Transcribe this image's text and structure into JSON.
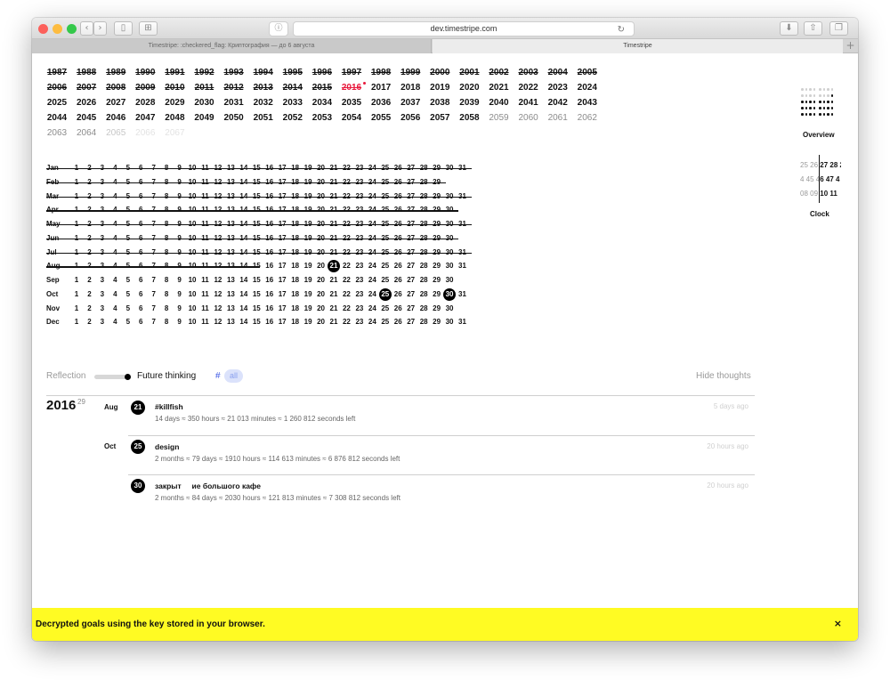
{
  "browser": {
    "url": "dev.timestripe.com",
    "reader_glyph": "ⓘ",
    "reload_glyph": "↻",
    "back_glyph": "‹",
    "forward_glyph": "›",
    "sidebar_glyph": "▯",
    "tabs_glyph": "⊞",
    "download_glyph": "⬇",
    "share_glyph": "⇧",
    "newwin_glyph": "❐",
    "tabs": [
      {
        "label": "Timestripe: :checkered_flag: Криптография — до 6 августа"
      },
      {
        "label": "Timestripe"
      }
    ],
    "new_tab_glyph": "+",
    "colors": {
      "close": "#fc605b",
      "minimize": "#fdbc40",
      "zoom": "#34c84a"
    }
  },
  "years": {
    "past_rows": [
      [
        "1987",
        "1988",
        "1989",
        "1990",
        "1991",
        "1992",
        "1993",
        "1994",
        "1995",
        "1996",
        "1997",
        "1998",
        "1999",
        "2000",
        "2001",
        "2002",
        "2003",
        "2004",
        "2005"
      ],
      [
        "2006",
        "2007",
        "2008",
        "2009",
        "2010",
        "2011",
        "2012",
        "2013",
        "2014",
        "2015"
      ]
    ],
    "current": "2016",
    "upcoming_row2": [
      "2017",
      "2018",
      "2019",
      "2020",
      "2021",
      "2022",
      "2023",
      "2024"
    ],
    "row3": [
      "2025",
      "2026",
      "2027",
      "2028",
      "2029",
      "2030",
      "2031",
      "2032",
      "2033",
      "2034",
      "2035",
      "2036",
      "2037",
      "2038",
      "2039",
      "2040",
      "2041",
      "2042",
      "2043"
    ],
    "row4": [
      "2044",
      "2045",
      "2046",
      "2047",
      "2048",
      "2049",
      "2050",
      "2051",
      "2052",
      "2053",
      "2054",
      "2055",
      "2056",
      "2057",
      "2058",
      "2059",
      "2060",
      "2061",
      "2062"
    ],
    "row5": [
      "2063",
      "2064",
      "2065",
      "2066",
      "2067"
    ],
    "accent": "#e8193c"
  },
  "calendar": {
    "months": [
      {
        "label": "Jan",
        "days": 31
      },
      {
        "label": "Feb",
        "days": 29
      },
      {
        "label": "Mar",
        "days": 31
      },
      {
        "label": "Apr",
        "days": 30
      },
      {
        "label": "May",
        "days": 31
      },
      {
        "label": "Jun",
        "days": 30
      },
      {
        "label": "Jul",
        "days": 31
      },
      {
        "label": "Aug",
        "days": 31
      },
      {
        "label": "Sep",
        "days": 30
      },
      {
        "label": "Oct",
        "days": 31
      },
      {
        "label": "Nov",
        "days": 30
      },
      {
        "label": "Dec",
        "days": 31
      }
    ],
    "today": {
      "month": "Aug",
      "day": 21
    },
    "marked": [
      {
        "month": "Oct",
        "day": 25
      },
      {
        "month": "Oct",
        "day": 30
      }
    ]
  },
  "filters": {
    "reflection": "Reflection",
    "future_thinking": "Future thinking",
    "hash": "#",
    "tag_all": "all",
    "hide_thoughts": "Hide thoughts"
  },
  "thoughts": {
    "year": "2016",
    "year_count": "29",
    "items": [
      {
        "month": "Aug",
        "day": "21",
        "title": "#killfish",
        "meta": "14 days ≈ 350 hours ≈ 21 013 minutes ≈ 1 260 812 seconds left",
        "ago": "5 days ago"
      },
      {
        "month": "Oct",
        "day": "25",
        "title": "design",
        "meta": "2 months ≈ 79 days ≈ 1910 hours ≈ 114 613 minutes ≈ 6 876 812 seconds left",
        "ago": "20 hours ago"
      },
      {
        "month": "",
        "day": "30",
        "title": "закрыт     ие большого кафе",
        "meta": "2 months ≈ 84 days ≈ 2030 hours ≈ 121 813 minutes ≈ 7 308 812 seconds left",
        "ago": "20 hours ago"
      }
    ]
  },
  "sidebar": {
    "overview_label": "Overview",
    "clock_label": "Clock",
    "clock_rows": [
      {
        "dim": "25 26 ",
        "bold": "27 28 2"
      },
      {
        "dim": "4 45 4",
        "bold": "6 47 4"
      },
      {
        "dim": "08 09 ",
        "bold": "10 11"
      }
    ]
  },
  "notice": {
    "text": "Decrypted goals using the key stored in your browser.",
    "close": "×"
  }
}
